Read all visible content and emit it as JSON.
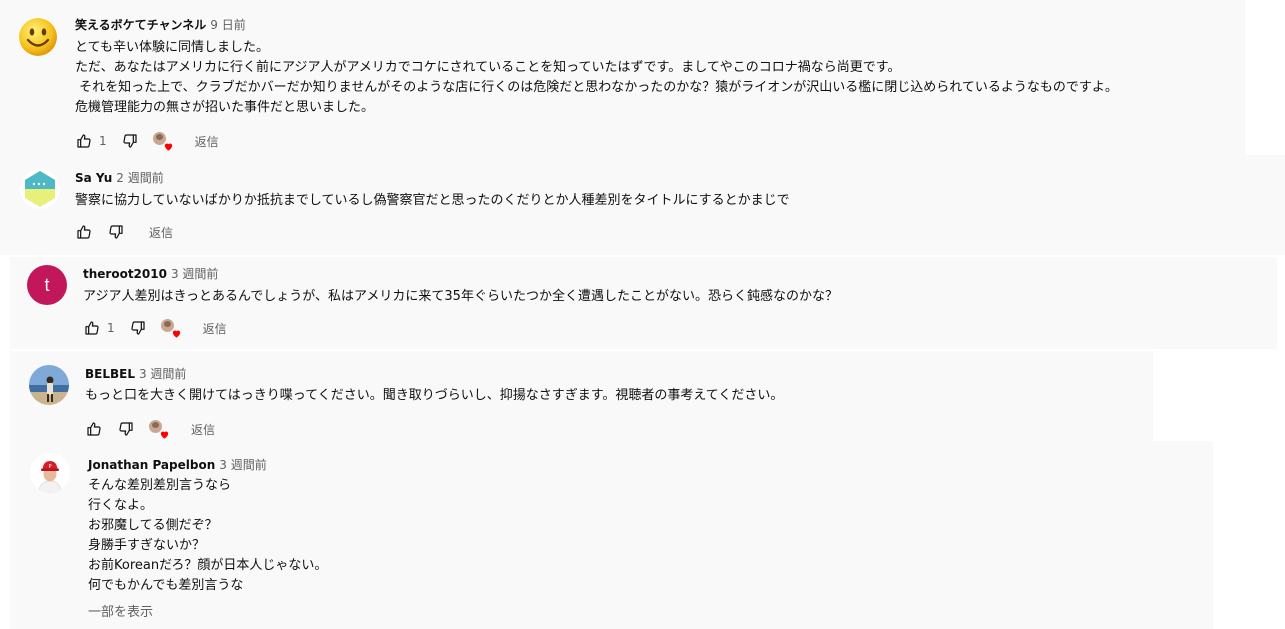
{
  "comments": [
    {
      "author": "笑えるボケてチャンネル",
      "timestamp": "9 日前",
      "avatar_icon": "smiley-face-avatar",
      "lines": [
        "とても辛い体験に同情しました。",
        "ただ、あなたはアメリカに行く前にアジア人がアメリカでコケにされていることを知っていたはずです。ましてやこのコロナ禍なら尚更です。",
        " それを知った上で、クラブだかバーだか知りませんがそのような店に行くのは危険だと思わなかったのかな？猿がライオンが沢山いる檻に閉じ込められているようなものですよ。",
        "危機管理能力の無さが招いた事件だと思いました。"
      ],
      "likes": "1",
      "hearted": true,
      "reply_label": "返信"
    },
    {
      "author": "Sa Yu",
      "timestamp": "2 週間前",
      "avatar_icon": "hexagon-avatar",
      "lines": [
        "警察に協力していないばかりか抵抗までしているし偽警察官だと思ったのくだりとか人種差別をタイトルにするとかまじで"
      ],
      "likes": "",
      "hearted": false,
      "reply_label": "返信"
    },
    {
      "author": "theroot2010",
      "timestamp": "3 週間前",
      "avatar_letter": "t",
      "avatar_color": "#c2185b",
      "lines": [
        "アジア人差別はきっとあるんでしょうが、私はアメリカに来て35年ぐらいたつか全く遭遇したことがない。恐らく鈍感なのかな？"
      ],
      "likes": "1",
      "hearted": true,
      "reply_label": "返信"
    },
    {
      "author": "BELBEL",
      "timestamp": "3 週間前",
      "avatar_icon": "beach-photo-avatar",
      "lines": [
        "もっと口を大きく開けてはっきり喋ってください。聞き取りづらいし、抑揚なさすぎます。視聴者の事考えてください。"
      ],
      "likes": "",
      "hearted": true,
      "reply_label": "返信"
    },
    {
      "author": "Jonathan Papelbon",
      "timestamp": "3 週間前",
      "avatar_icon": "baseball-player-avatar",
      "lines": [
        "そんな差別差別言うなら",
        "行くなよ。",
        "お邪魔してる側だぞ？",
        "身勝手すぎないか？",
        "お前Koreanだろ？顔が日本人じゃない。",
        "何でもかんでも差別言うな"
      ],
      "show_more": "一部を表示"
    }
  ]
}
